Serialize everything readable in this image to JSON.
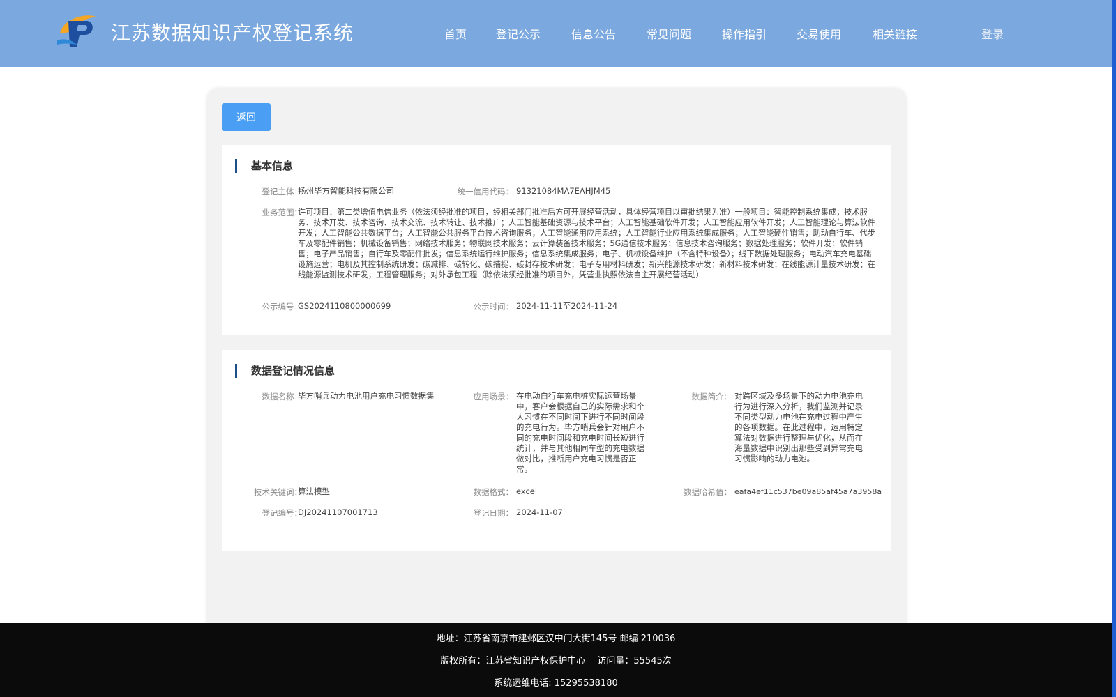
{
  "header": {
    "title": "江苏数据知识产权登记系统",
    "nav": [
      "首页",
      "登记公示",
      "信息公告",
      "常见问题",
      "操作指引",
      "交易使用",
      "相关链接"
    ],
    "login": "登录"
  },
  "back_label": "返回",
  "basic": {
    "heading": "基本信息",
    "subject_label": "登记主体：",
    "subject": "扬州毕方智能科技有限公司",
    "credit_label": "统一信用代码：",
    "credit": "91321084MA7EAHJM45",
    "scope_label": "业务范围：",
    "scope": "许可项目：第二类增值电信业务（依法须经批准的项目，经相关部门批准后方可开展经营活动，具体经营项目以审批结果为准）一般项目：智能控制系统集成；技术服务、技术开发、技术咨询、技术交流、技术转让、技术推广；人工智能基础资源与技术平台；人工智能基础软件开发；人工智能应用软件开发；人工智能理论与算法软件开发；人工智能公共数据平台；人工智能公共服务平台技术咨询服务；人工智能通用应用系统；人工智能行业应用系统集成服务；人工智能硬件销售；助动自行车、代步车及零配件销售；机械设备销售；网络技术服务；物联网技术服务；云计算装备技术服务；5G通信技术服务；信息技术咨询服务；数据处理服务；软件开发；软件销售；电子产品销售；自行车及零配件批发；信息系统运行维护服务；信息系统集成服务；电子、机械设备维护（不含特种设备）；线下数据处理服务；电动汽车充电基础设施运营；电机及其控制系统研发；碳减排、碳转化、碳捕捉、碳封存技术研发；电子专用材料研发；新兴能源技术研发；新材料技术研发；在线能源计量技术研发；在线能源监测技术研发；工程管理服务；对外承包工程（除依法须经批准的项目外，凭营业执照依法自主开展经营活动）",
    "pub_no_label": "公示编号：",
    "pub_no": "GS2024110800000699",
    "pub_time_label": "公示时间：",
    "pub_time": "2024-11-11至2024-11-24"
  },
  "data": {
    "heading": "数据登记情况信息",
    "name_label": "数据名称：",
    "name": "毕方哨兵动力电池用户充电习惯数据集",
    "scene_label": "应用场景：",
    "scene": "在电动自行车充电桩实际运营场景中，客户会根据自己的实际需求和个人习惯在不同时间下进行不同时间段的充电行为。毕方哨兵会针对用户不同的充电时间段和充电时间长短进行统计，并与其他相同车型的充电数据做对比，推断用户充电习惯是否正常。",
    "intro_label": "数据简介：",
    "intro": "对跨区域及多场景下的动力电池充电行为进行深入分析，我们监测并记录不同类型动力电池在充电过程中产生的各项数据。在此过程中，运用特定算法对数据进行整理与优化，从而在海量数据中识别出那些受到异常充电习惯影响的动力电池。",
    "keyword_label": "技术关键词：",
    "keyword": "算法模型",
    "format_label": "数据格式：",
    "format": "excel",
    "hash_label": "数据哈希值：",
    "hash": "eafa4ef11c537be09a85af45a7a3958a",
    "reg_no_label": "登记编号：",
    "reg_no": "DJ20241107001713",
    "reg_date_label": "登记日期：",
    "reg_date": "2024-11-07"
  },
  "footer": {
    "address": "地址：江苏省南京市建邺区汉中门大街145号 邮编 210036",
    "copyright": "版权所有：江苏省知识产权保护中心　 访问量：55545次",
    "phone": "系统运维电话: 15295538180"
  },
  "colors": {
    "header_bg": "#7ba8de",
    "button_blue": "#4a9ff5",
    "heading_bar": "#1a4f8a",
    "footer_bg": "#0b0b0b"
  }
}
